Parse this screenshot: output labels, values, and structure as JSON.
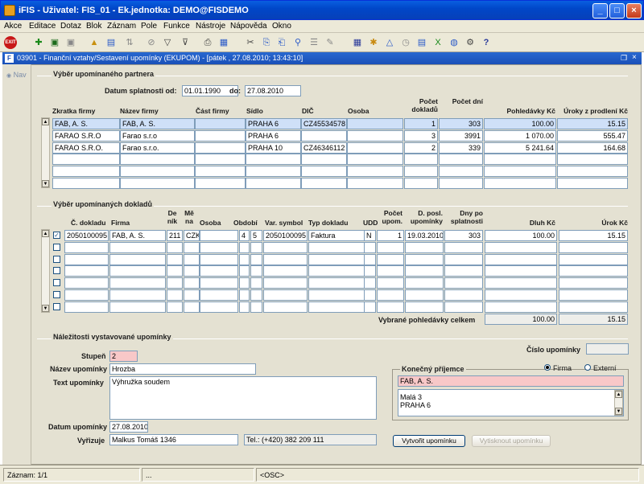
{
  "window": {
    "title": "iFIS - Uživatel: FIS_01 - Ek.jednotka: DEMO@FISDEMO"
  },
  "menu": [
    "Akce",
    "Editace",
    "Dotaz",
    "Blok",
    "Záznam",
    "Pole",
    "Funkce",
    "Nástroje",
    "Nápověda",
    "Okno"
  ],
  "doc_title": "03901 - Finanční vztahy/Sestavení upomínky (EKUPOM) - [pátek , 27.08.2010; 13:43:10]",
  "nav_label": "Nav",
  "partner_section": {
    "title": "Výběr upomínaného partnera",
    "date_label": "Datum splatnosti od:",
    "date_from": "01.01.1990",
    "date_to_label": "do:",
    "date_to": "27.08.2010",
    "columns": [
      "Zkratka firmy",
      "Název firmy",
      "Část firmy",
      "Sídlo",
      "DIČ",
      "Osoba",
      "Počet dokladů",
      "Počet dní",
      "Pohledávky Kč",
      "Úroky z prodlení Kč"
    ],
    "rows": [
      [
        "FAB, A. S.",
        "FAB, A. S.",
        "",
        "PRAHA 6",
        "CZ45534578",
        "",
        "1",
        "303",
        "100.00",
        "15.15"
      ],
      [
        "FARAO S.R.O",
        "Farao s.r.o",
        "",
        "PRAHA 6",
        "",
        "",
        "3",
        "3991",
        "1 070.00",
        "555.47"
      ],
      [
        "FARAO S.R.O.",
        "Farao s.r.o.",
        "",
        "PRAHA 10",
        "CZ46346112",
        "",
        "2",
        "339",
        "5 241.64",
        "164.68"
      ],
      [
        "",
        "",
        "",
        "",
        "",
        "",
        "",
        "",
        "",
        ""
      ],
      [
        "",
        "",
        "",
        "",
        "",
        "",
        "",
        "",
        "",
        ""
      ],
      [
        "",
        "",
        "",
        "",
        "",
        "",
        "",
        "",
        "",
        ""
      ]
    ]
  },
  "docs_section": {
    "title": "Výběr upomínaných dokladů",
    "columns": [
      "Č. dokladu",
      "Firma",
      "Deník",
      "Měna",
      "Osoba",
      "Období",
      "Var. symbol",
      "Typ dokladu",
      "UDD",
      "Počet upom.",
      "D. posl. upomínky",
      "Dny po splatnosti",
      "Dluh Kč",
      "Úrok Kč"
    ],
    "rows": [
      [
        "2050100095",
        "FAB, A. S.",
        "211",
        "CZK",
        "",
        "4",
        "5",
        "2050100095",
        "Faktura",
        "N",
        "1",
        "19.03.2010",
        "303",
        "100.00",
        "15.15"
      ],
      [
        "",
        "",
        "",
        "",
        "",
        "",
        "",
        "",
        "",
        "",
        "",
        "",
        "",
        "",
        ""
      ],
      [
        "",
        "",
        "",
        "",
        "",
        "",
        "",
        "",
        "",
        "",
        "",
        "",
        "",
        "",
        ""
      ],
      [
        "",
        "",
        "",
        "",
        "",
        "",
        "",
        "",
        "",
        "",
        "",
        "",
        "",
        "",
        ""
      ],
      [
        "",
        "",
        "",
        "",
        "",
        "",
        "",
        "",
        "",
        "",
        "",
        "",
        "",
        "",
        ""
      ],
      [
        "",
        "",
        "",
        "",
        "",
        "",
        "",
        "",
        "",
        "",
        "",
        "",
        "",
        "",
        ""
      ],
      [
        "",
        "",
        "",
        "",
        "",
        "",
        "",
        "",
        "",
        "",
        "",
        "",
        "",
        "",
        ""
      ]
    ],
    "total_label": "Vybrané pohledávky celkem",
    "total_dluh": "100.00",
    "total_urok": "15.15"
  },
  "reminder_section": {
    "title": "Náležitosti vystavované upomínky",
    "stupen_label": "Stupeň",
    "stupen": "2",
    "cislo_label": "Číslo upomínky",
    "cislo": "",
    "nazev_label": "Název upomínky",
    "nazev": "Hrozba",
    "text_label": "Text upomínky",
    "text": "Výhružka soudem",
    "prijemce_label": "Konečný příjemce",
    "radio_firma": "Firma",
    "radio_externi": "Externí",
    "prijemce_name": "FAB, A. S.",
    "prijemce_addr1": "Malá 3",
    "prijemce_addr2": "PRAHA 6",
    "datum_label": "Datum upomínky",
    "datum": "27.08.2010",
    "vyrizuje_label": "Vyřizuje",
    "vyrizuje": "Malkus Tomáš 1346",
    "telefon": "Tel.: (+420) 382 209 111",
    "btn_create": "Vytvořit upomínku",
    "btn_print": "Vytisknout upomínku"
  },
  "status": {
    "record": "Záznam: 1/1",
    "dots": "...",
    "osc": "<OSC>"
  }
}
